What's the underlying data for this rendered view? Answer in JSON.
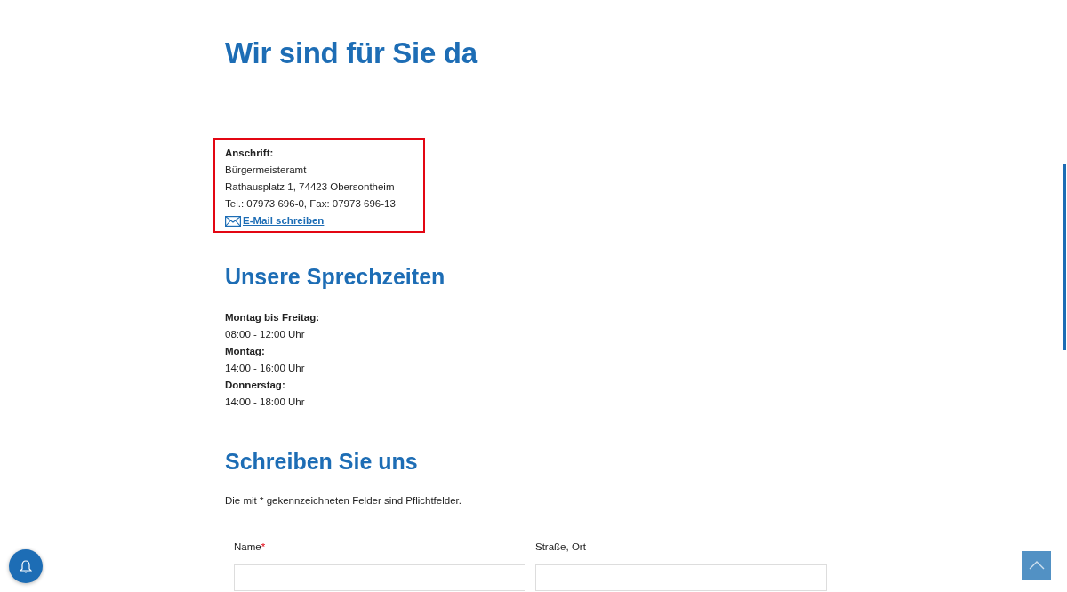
{
  "heading": "Wir sind für Sie da",
  "address": {
    "highlighted": true,
    "label": "Anschrift:",
    "lines": [
      "Bürgermeisteramt",
      "Rathausplatz 1, 74423 Obersontheim",
      "Tel.: 07973 696-0, Fax: 07973 696-13"
    ],
    "email_link": "E-Mail schreiben"
  },
  "hours": {
    "title": "Unsere Sprechzeiten",
    "entries": [
      {
        "day": "Montag bis Freitag:",
        "time": "08:00 - 12:00 Uhr"
      },
      {
        "day": "Montag:",
        "time": "14:00 - 16:00 Uhr"
      },
      {
        "day": "Donnerstag:",
        "time": "14:00 - 18:00 Uhr"
      }
    ]
  },
  "form": {
    "title": "Schreiben Sie uns",
    "note": "Die mit * gekennzeichneten Felder sind Pflichtfelder.",
    "required_mark": "*",
    "fields": [
      {
        "label": "Name",
        "required": true
      },
      {
        "label": "Straße, Ort",
        "required": false
      }
    ]
  }
}
